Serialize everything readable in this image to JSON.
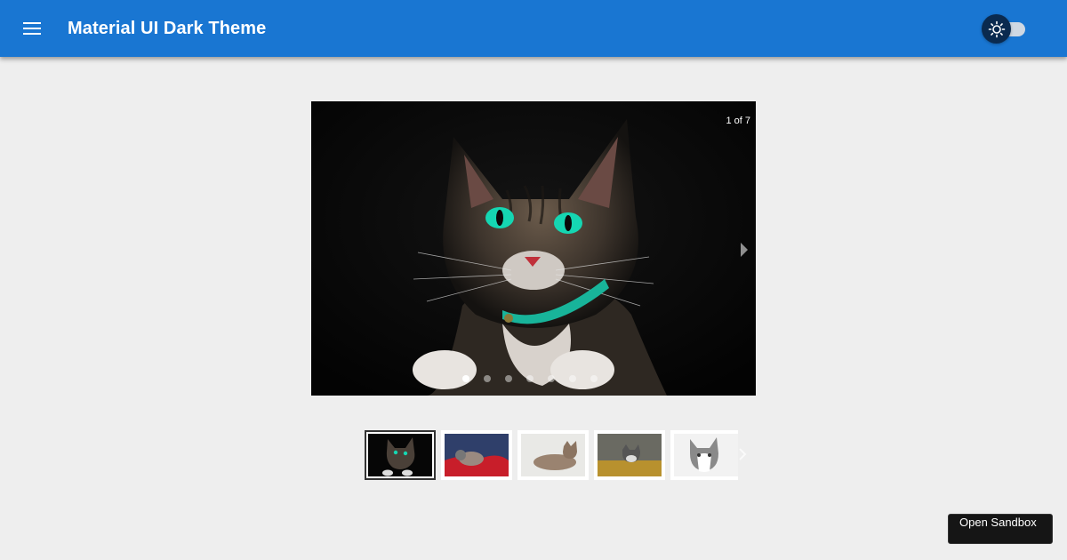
{
  "header": {
    "title": "Material UI Dark Theme",
    "menu_icon": "hamburger-menu-icon",
    "theme_toggle_icon": "sun-icon",
    "background": "#1976d2"
  },
  "carousel": {
    "counter": "1 of 7",
    "current_index": 1,
    "total": 7,
    "next_icon": "chevron-right-icon"
  },
  "thumbnails": {
    "selected_index": 0,
    "count_visible": 5
  },
  "sandbox_button": {
    "label": "Open Sandbox"
  }
}
